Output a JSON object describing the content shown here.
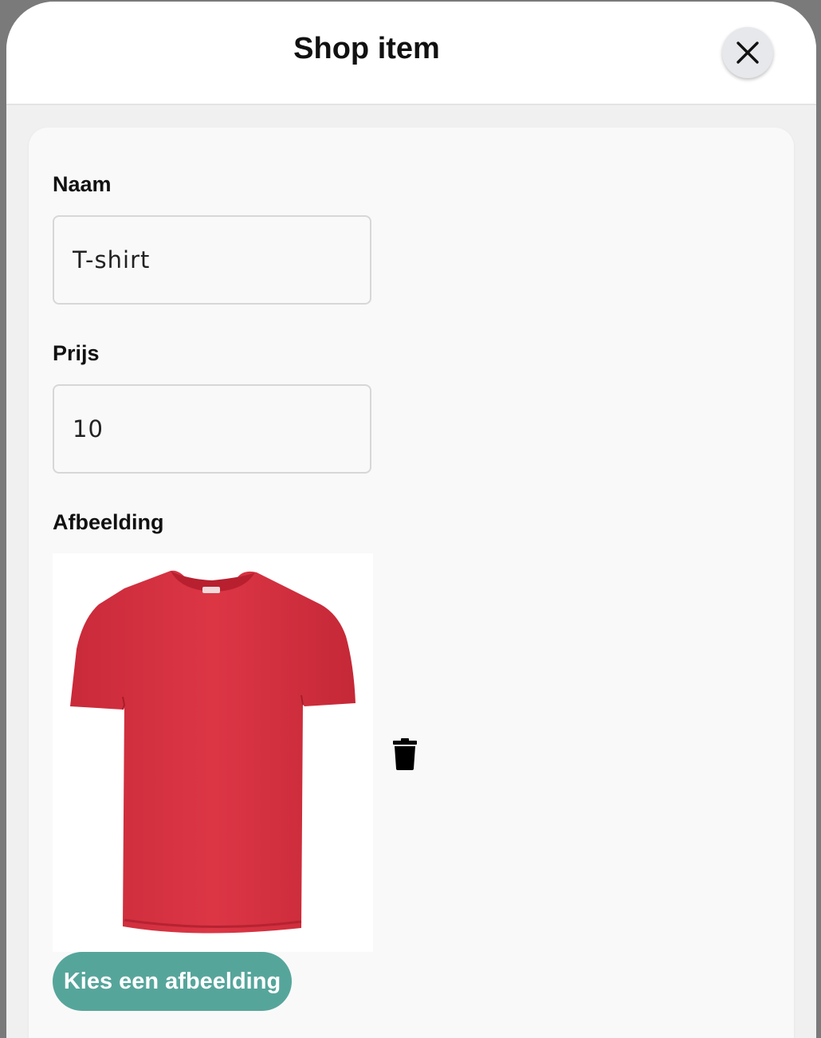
{
  "modal": {
    "title": "Shop item",
    "close_icon": "close-icon"
  },
  "form": {
    "name": {
      "label": "Naam",
      "value": "T-shirt"
    },
    "price": {
      "label": "Prijs",
      "value": "10"
    },
    "image": {
      "label": "Afbeelding",
      "preview": "red t-shirt",
      "preview_color": "#d7303f",
      "delete_icon": "trash-icon",
      "choose_label": "Kies een afbeelding"
    }
  },
  "colors": {
    "accent": "#56a59b"
  }
}
